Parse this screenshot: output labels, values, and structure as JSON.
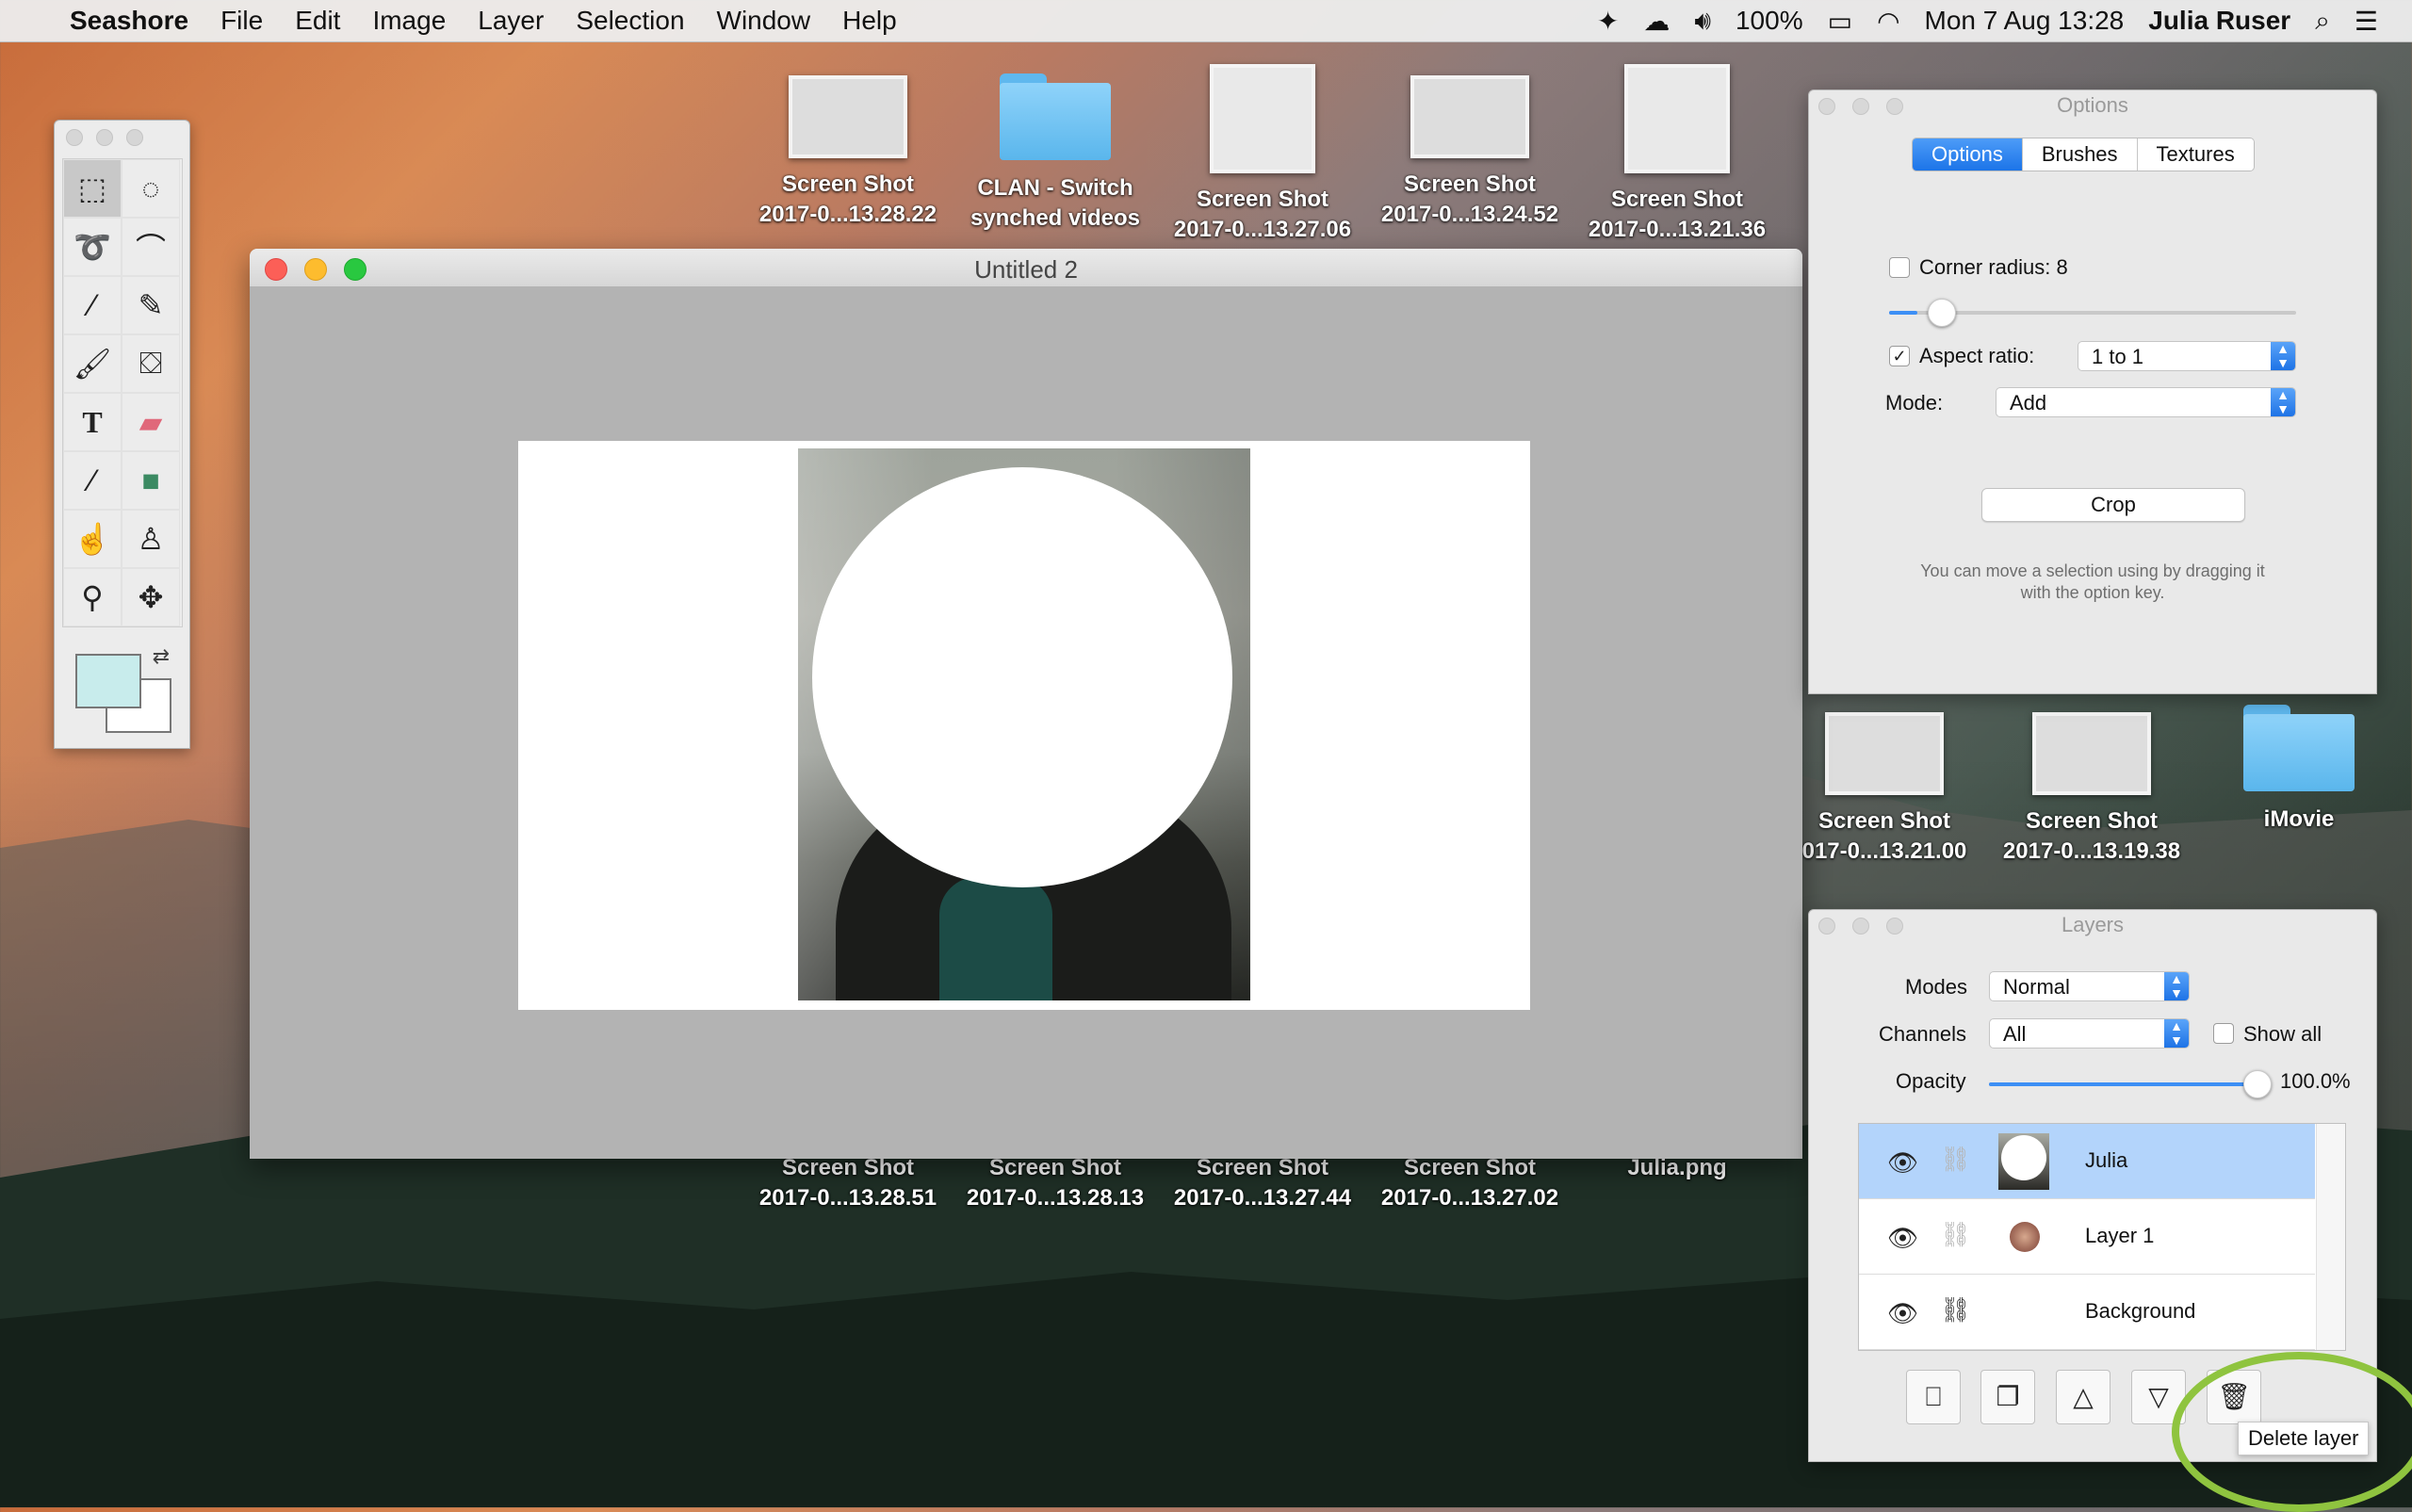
{
  "menubar": {
    "app_name": "Seashore",
    "menus": [
      "File",
      "Edit",
      "Image",
      "Layer",
      "Selection",
      "Window",
      "Help"
    ],
    "battery": "100%",
    "datetime": "Mon 7 Aug  13:28",
    "user": "Julia Ruser"
  },
  "desktop_icons_top": [
    {
      "line1": "Screen Shot",
      "line2": "2017-0...13.28.22"
    },
    {
      "line1": "CLAN - Switch",
      "line2": "synched videos"
    },
    {
      "line1": "Screen Shot",
      "line2": "2017-0...13.27.06"
    },
    {
      "line1": "Screen Shot",
      "line2": "2017-0...13.24.52"
    },
    {
      "line1": "Screen Shot",
      "line2": "2017-0...13.21.36"
    }
  ],
  "desktop_icons_right": [
    {
      "line1": "Screen Shot",
      "line2": "017-0...13.21.00"
    },
    {
      "line1": "Screen Shot",
      "line2": "2017-0...13.19.38"
    },
    {
      "line1": "iMovie",
      "line2": ""
    }
  ],
  "desktop_icons_bottom": [
    {
      "line1": "Screen Shot",
      "line2": "2017-0...13.28.51"
    },
    {
      "line1": "Screen Shot",
      "line2": "2017-0...13.28.13"
    },
    {
      "line1": "Screen Shot",
      "line2": "2017-0...13.27.44"
    },
    {
      "line1": "Screen Shot",
      "line2": "2017-0...13.27.02"
    },
    {
      "line1": "Julia.png",
      "line2": ""
    }
  ],
  "document": {
    "title": "Untitled 2"
  },
  "options_panel": {
    "title": "Options",
    "tabs": [
      "Options",
      "Brushes",
      "Textures"
    ],
    "active_tab": "Options",
    "corner_radius_label": "Corner radius: 8",
    "corner_radius_checked": false,
    "aspect_ratio_label": "Aspect ratio:",
    "aspect_ratio_checked": true,
    "aspect_ratio_value": "1 to 1",
    "mode_label": "Mode:",
    "mode_value": "Add",
    "crop_label": "Crop",
    "hint_line1": "You can move a selection using by dragging it",
    "hint_line2": "with the option key."
  },
  "layers_panel": {
    "title": "Layers",
    "modes_label": "Modes",
    "modes_value": "Normal",
    "channels_label": "Channels",
    "channels_value": "All",
    "show_all_label": "Show all",
    "opacity_label": "Opacity",
    "opacity_value": "100.0%",
    "opacity_fraction": 1.0,
    "layers": [
      {
        "name": "Julia",
        "selected": true
      },
      {
        "name": "Layer 1",
        "selected": false
      },
      {
        "name": "Background",
        "selected": false
      }
    ],
    "tooltip": "Delete layer"
  },
  "colors": {
    "accent": "#1c74e8",
    "selection_row": "#b3d4fb",
    "highlight_ring": "#8fc43f"
  }
}
